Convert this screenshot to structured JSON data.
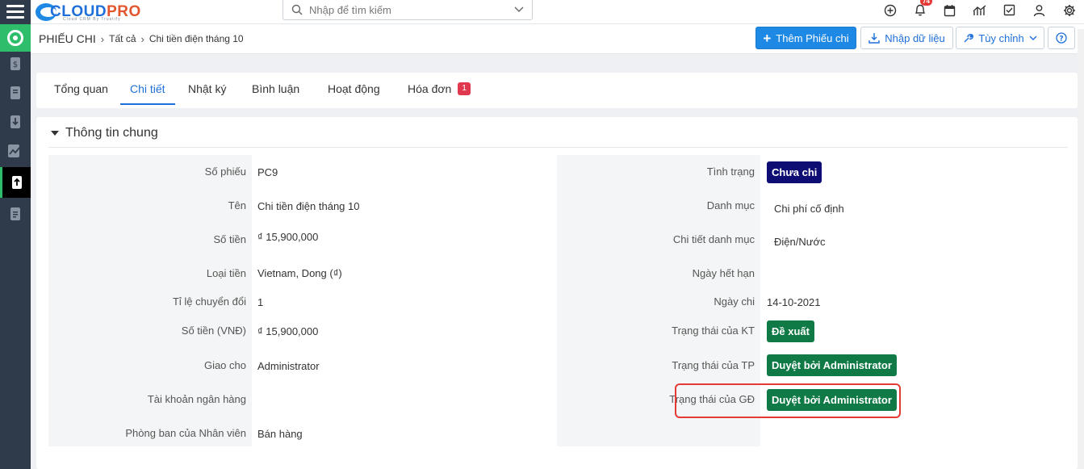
{
  "app": {
    "brand_part1": "CLOUD",
    "brand_part2": "PRO",
    "brand_tagline": "Cloud CRM By Trustify"
  },
  "search": {
    "placeholder": "Nhập để tìm kiếm"
  },
  "topbar": {
    "icons": [
      "plus-circle-icon",
      "bell-icon",
      "calendar-icon",
      "chart-icon",
      "checkbox-icon",
      "user-icon",
      "gear-icon"
    ],
    "notification_count": "74"
  },
  "breadcrumb": {
    "module": "PHIẾU CHI",
    "level1": "Tất cả",
    "current": "Chi tiền điện tháng 10"
  },
  "actions": {
    "add_label": "Thêm Phiếu chi",
    "import_label": "Nhập dữ liệu",
    "customize_label": "Tùy chỉnh"
  },
  "tabs": [
    {
      "label": "Tổng quan"
    },
    {
      "label": "Chi tiết"
    },
    {
      "label": "Nhật ký"
    },
    {
      "label": "Bình luận"
    },
    {
      "label": "Hoạt động"
    },
    {
      "label": "Hóa đơn",
      "badge": "1"
    }
  ],
  "section": {
    "title": "Thông tin chung",
    "left_fields": [
      {
        "label": "Số phiếu",
        "value": "PC9"
      },
      {
        "label": "Tên",
        "value": "Chi tiền điện tháng 10"
      },
      {
        "label": "Số tiền",
        "value": "₫ 15,900,000"
      },
      {
        "label": "Loại tiền",
        "value": "Vietnam, Dong (₫)"
      },
      {
        "label": "Tỉ lệ chuyển đổi",
        "value": "1"
      },
      {
        "label": "Số tiền (VNĐ)",
        "value": "₫ 15,900,000"
      },
      {
        "label": "Giao cho",
        "value": "Administrator"
      },
      {
        "label": "Tài khoản ngân hàng",
        "value": ""
      },
      {
        "label": "Phòng ban của Nhân viên",
        "value": "Bán hàng"
      }
    ],
    "right_fields": [
      {
        "label": "Tình trạng",
        "value": "Chưa chi",
        "badge_color": "#0d0d73"
      },
      {
        "label": "Danh mục",
        "value": "Chi phí cố định"
      },
      {
        "label": "Chi tiết danh mục",
        "value": "Điện/Nước"
      },
      {
        "label": "Ngày hết hạn",
        "value": ""
      },
      {
        "label": "Ngày chi",
        "value": "14-10-2021"
      },
      {
        "label": "Trạng thái của KT",
        "value": "Đề xuất",
        "badge_color": "#0f7a45"
      },
      {
        "label": "Trạng thái của TP",
        "value": "Duyệt bởi Administrator",
        "badge_color": "#0f7a45"
      },
      {
        "label": "Trạng thái của GĐ",
        "value": "Duyệt bởi Administrator",
        "badge_color": "#0f7a45"
      }
    ]
  },
  "colors": {
    "accent": "#1e88e5",
    "sidebar": "#2f3a4b",
    "home": "#2ebd6b",
    "highlight": "#e53935"
  }
}
